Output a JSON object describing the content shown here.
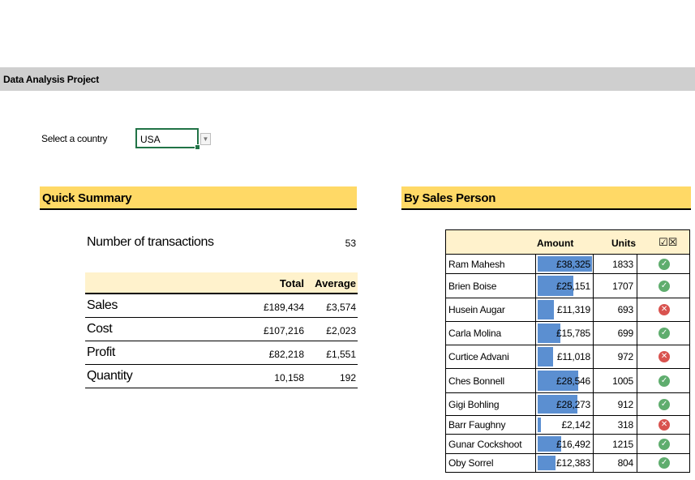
{
  "title_bar": {
    "title": "Data Analysis Project"
  },
  "country_selector": {
    "label": "Select a country",
    "value": "USA"
  },
  "quick_summary": {
    "title": "Quick Summary",
    "transactions_label": "Number of transactions",
    "transactions_value": "53",
    "col_total": "Total",
    "col_average": "Average",
    "rows": [
      {
        "label": "Sales",
        "total": "£189,434",
        "average": "£3,574"
      },
      {
        "label": "Cost",
        "total": "£107,216",
        "average": "£2,023"
      },
      {
        "label": "Profit",
        "total": "£82,218",
        "average": "£1,551"
      },
      {
        "label": "Quantity",
        "total": "10,158",
        "average": "192"
      }
    ]
  },
  "by_sales_person": {
    "title": "By Sales Person",
    "col_amount": "Amount",
    "col_units": "Units",
    "col_status": "☑☒",
    "max_amount": 38325,
    "rows": [
      {
        "name": "Ram Mahesh",
        "amount": "£38,325",
        "amount_value": 38325,
        "units": "1833",
        "status": "ok"
      },
      {
        "name": "Brien Boise",
        "amount": "£25,151",
        "amount_value": 25151,
        "units": "1707",
        "status": "ok"
      },
      {
        "name": "Husein Augar",
        "amount": "£11,319",
        "amount_value": 11319,
        "units": "693",
        "status": "fail"
      },
      {
        "name": "Carla Molina",
        "amount": "£15,785",
        "amount_value": 15785,
        "units": "699",
        "status": "ok"
      },
      {
        "name": "Curtice Advani",
        "amount": "£11,018",
        "amount_value": 11018,
        "units": "972",
        "status": "fail"
      },
      {
        "name": "Ches Bonnell",
        "amount": "£28,546",
        "amount_value": 28546,
        "units": "1005",
        "status": "ok"
      },
      {
        "name": "Gigi Bohling",
        "amount": "£28,273",
        "amount_value": 28273,
        "units": "912",
        "status": "ok"
      },
      {
        "name": "Barr Faughny",
        "amount": "£2,142",
        "amount_value": 2142,
        "units": "318",
        "status": "fail"
      },
      {
        "name": "Gunar Cockshoot",
        "amount": "£16,492",
        "amount_value": 16492,
        "units": "1215",
        "status": "ok"
      },
      {
        "name": "Oby Sorrel",
        "amount": "£12,383",
        "amount_value": 12383,
        "units": "804",
        "status": "ok"
      }
    ]
  },
  "colors": {
    "title_bar": "#cfcfcf",
    "section_header": "#ffd966",
    "table_header": "#fff2cc",
    "data_bar": "#5b8fd1",
    "ok": "#5fad6e",
    "fail": "#d9534f",
    "selection": "#217346"
  },
  "icons": {
    "ok": "check-circle-icon",
    "fail": "x-circle-icon",
    "dropdown": "chevron-down-icon"
  }
}
